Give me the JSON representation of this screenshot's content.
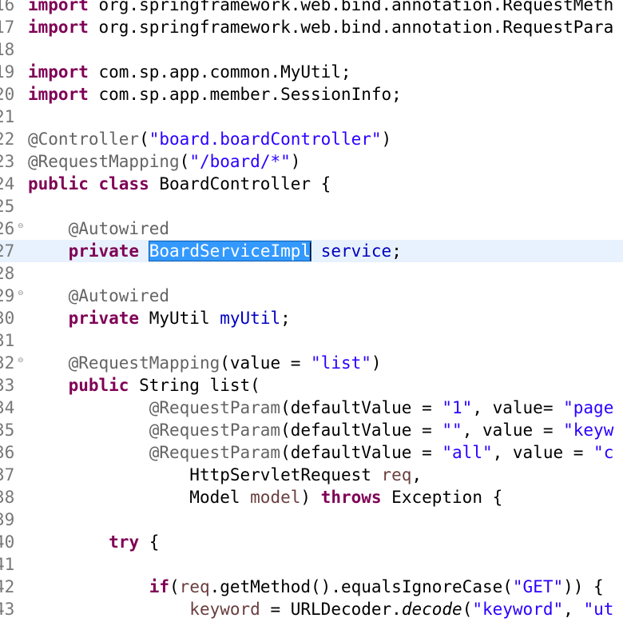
{
  "editor": {
    "current_line_index": 11,
    "lines": [
      {
        "no": "16",
        "segs": [
          {
            "t": "import",
            "c": "kw"
          },
          {
            "t": " org.springframework.web.bind.annotation.RequestMeth",
            "c": ""
          }
        ]
      },
      {
        "no": "17",
        "segs": [
          {
            "t": "import",
            "c": "kw"
          },
          {
            "t": " org.springframework.web.bind.annotation.RequestPara",
            "c": ""
          }
        ]
      },
      {
        "no": "18",
        "segs": []
      },
      {
        "no": "19",
        "segs": [
          {
            "t": "import",
            "c": "kw"
          },
          {
            "t": " com.sp.app.common.MyUtil;",
            "c": ""
          }
        ]
      },
      {
        "no": "20",
        "segs": [
          {
            "t": "import",
            "c": "kw"
          },
          {
            "t": " com.sp.app.member.SessionInfo;",
            "c": ""
          }
        ]
      },
      {
        "no": "21",
        "segs": []
      },
      {
        "no": "22",
        "segs": [
          {
            "t": "@Controller",
            "c": "ann"
          },
          {
            "t": "(",
            "c": ""
          },
          {
            "t": "\"board.boardController\"",
            "c": "str"
          },
          {
            "t": ")",
            "c": ""
          }
        ]
      },
      {
        "no": "23",
        "segs": [
          {
            "t": "@RequestMapping",
            "c": "ann"
          },
          {
            "t": "(",
            "c": ""
          },
          {
            "t": "\"/board/*\"",
            "c": "str"
          },
          {
            "t": ")",
            "c": ""
          }
        ]
      },
      {
        "no": "24",
        "segs": [
          {
            "t": "public",
            "c": "kw"
          },
          {
            "t": " ",
            "c": ""
          },
          {
            "t": "class",
            "c": "kw"
          },
          {
            "t": " BoardController {",
            "c": ""
          }
        ]
      },
      {
        "no": "25",
        "segs": []
      },
      {
        "no": "26",
        "fold": true,
        "segs": [
          {
            "t": "    ",
            "c": ""
          },
          {
            "t": "@Autowired",
            "c": "ann"
          }
        ]
      },
      {
        "no": "27",
        "segs": [
          {
            "t": "    ",
            "c": ""
          },
          {
            "t": "private",
            "c": "kw"
          },
          {
            "t": " ",
            "c": ""
          },
          {
            "t": "BoardServiceImpl",
            "c": "sel"
          },
          {
            "t": "",
            "c": "caret"
          },
          {
            "t": " ",
            "c": ""
          },
          {
            "t": "service",
            "c": "fld"
          },
          {
            "t": ";",
            "c": ""
          }
        ]
      },
      {
        "no": "28",
        "segs": []
      },
      {
        "no": "29",
        "fold": true,
        "segs": [
          {
            "t": "    ",
            "c": ""
          },
          {
            "t": "@Autowired",
            "c": "ann"
          }
        ]
      },
      {
        "no": "30",
        "segs": [
          {
            "t": "    ",
            "c": ""
          },
          {
            "t": "private",
            "c": "kw"
          },
          {
            "t": " MyUtil ",
            "c": ""
          },
          {
            "t": "myUtil",
            "c": "fld"
          },
          {
            "t": ";",
            "c": ""
          }
        ]
      },
      {
        "no": "31",
        "segs": []
      },
      {
        "no": "32",
        "fold": true,
        "segs": [
          {
            "t": "    ",
            "c": ""
          },
          {
            "t": "@RequestMapping",
            "c": "ann"
          },
          {
            "t": "(value = ",
            "c": ""
          },
          {
            "t": "\"list\"",
            "c": "str"
          },
          {
            "t": ")",
            "c": ""
          }
        ]
      },
      {
        "no": "33",
        "segs": [
          {
            "t": "    ",
            "c": ""
          },
          {
            "t": "public",
            "c": "kw"
          },
          {
            "t": " String list(",
            "c": ""
          }
        ]
      },
      {
        "no": "34",
        "segs": [
          {
            "t": "            ",
            "c": ""
          },
          {
            "t": "@RequestParam",
            "c": "ann"
          },
          {
            "t": "(defaultValue = ",
            "c": ""
          },
          {
            "t": "\"1\"",
            "c": "str"
          },
          {
            "t": ", value= ",
            "c": ""
          },
          {
            "t": "\"page",
            "c": "str"
          }
        ]
      },
      {
        "no": "35",
        "segs": [
          {
            "t": "            ",
            "c": ""
          },
          {
            "t": "@RequestParam",
            "c": "ann"
          },
          {
            "t": "(defaultValue = ",
            "c": ""
          },
          {
            "t": "\"\"",
            "c": "str"
          },
          {
            "t": ", value = ",
            "c": ""
          },
          {
            "t": "\"keyw",
            "c": "str"
          }
        ]
      },
      {
        "no": "36",
        "segs": [
          {
            "t": "            ",
            "c": ""
          },
          {
            "t": "@RequestParam",
            "c": "ann"
          },
          {
            "t": "(defaultValue = ",
            "c": ""
          },
          {
            "t": "\"all\"",
            "c": "str"
          },
          {
            "t": ", value = ",
            "c": ""
          },
          {
            "t": "\"c",
            "c": "str"
          }
        ]
      },
      {
        "no": "37",
        "segs": [
          {
            "t": "                ",
            "c": ""
          },
          {
            "t": "HttpServletRequest ",
            "c": ""
          },
          {
            "t": "req",
            "c": "var"
          },
          {
            "t": ",",
            "c": ""
          }
        ]
      },
      {
        "no": "38",
        "segs": [
          {
            "t": "                ",
            "c": ""
          },
          {
            "t": "Model ",
            "c": ""
          },
          {
            "t": "model",
            "c": "var"
          },
          {
            "t": ") ",
            "c": ""
          },
          {
            "t": "throws",
            "c": "kw"
          },
          {
            "t": " Exception {",
            "c": ""
          }
        ]
      },
      {
        "no": "39",
        "segs": []
      },
      {
        "no": "40",
        "segs": [
          {
            "t": "        ",
            "c": ""
          },
          {
            "t": "try",
            "c": "kw"
          },
          {
            "t": " {",
            "c": ""
          }
        ]
      },
      {
        "no": "41",
        "segs": []
      },
      {
        "no": "42",
        "segs": [
          {
            "t": "            ",
            "c": ""
          },
          {
            "t": "if",
            "c": "kw"
          },
          {
            "t": "(",
            "c": ""
          },
          {
            "t": "req",
            "c": "var"
          },
          {
            "t": ".getMethod().equalsIgnoreCase(",
            "c": ""
          },
          {
            "t": "\"GET\"",
            "c": "str"
          },
          {
            "t": ")) {",
            "c": ""
          }
        ]
      },
      {
        "no": "43",
        "segs": [
          {
            "t": "                ",
            "c": ""
          },
          {
            "t": "keyword",
            "c": "var"
          },
          {
            "t": " = URLDecoder.",
            "c": ""
          },
          {
            "t": "decode",
            "c": "itl"
          },
          {
            "t": "(",
            "c": ""
          },
          {
            "t": "\"keyword\"",
            "c": "str"
          },
          {
            "t": ", ",
            "c": ""
          },
          {
            "t": "\"ut",
            "c": "str"
          }
        ]
      }
    ]
  }
}
